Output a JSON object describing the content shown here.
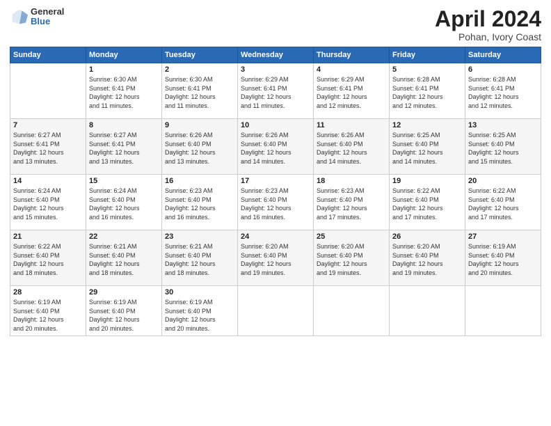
{
  "header": {
    "logo_general": "General",
    "logo_blue": "Blue",
    "title": "April 2024",
    "location": "Pohan, Ivory Coast"
  },
  "days_of_week": [
    "Sunday",
    "Monday",
    "Tuesday",
    "Wednesday",
    "Thursday",
    "Friday",
    "Saturday"
  ],
  "weeks": [
    [
      {
        "day": "",
        "info": ""
      },
      {
        "day": "1",
        "info": "Sunrise: 6:30 AM\nSunset: 6:41 PM\nDaylight: 12 hours\nand 11 minutes."
      },
      {
        "day": "2",
        "info": "Sunrise: 6:30 AM\nSunset: 6:41 PM\nDaylight: 12 hours\nand 11 minutes."
      },
      {
        "day": "3",
        "info": "Sunrise: 6:29 AM\nSunset: 6:41 PM\nDaylight: 12 hours\nand 11 minutes."
      },
      {
        "day": "4",
        "info": "Sunrise: 6:29 AM\nSunset: 6:41 PM\nDaylight: 12 hours\nand 12 minutes."
      },
      {
        "day": "5",
        "info": "Sunrise: 6:28 AM\nSunset: 6:41 PM\nDaylight: 12 hours\nand 12 minutes."
      },
      {
        "day": "6",
        "info": "Sunrise: 6:28 AM\nSunset: 6:41 PM\nDaylight: 12 hours\nand 12 minutes."
      }
    ],
    [
      {
        "day": "7",
        "info": "Sunrise: 6:27 AM\nSunset: 6:41 PM\nDaylight: 12 hours\nand 13 minutes."
      },
      {
        "day": "8",
        "info": "Sunrise: 6:27 AM\nSunset: 6:41 PM\nDaylight: 12 hours\nand 13 minutes."
      },
      {
        "day": "9",
        "info": "Sunrise: 6:26 AM\nSunset: 6:40 PM\nDaylight: 12 hours\nand 13 minutes."
      },
      {
        "day": "10",
        "info": "Sunrise: 6:26 AM\nSunset: 6:40 PM\nDaylight: 12 hours\nand 14 minutes."
      },
      {
        "day": "11",
        "info": "Sunrise: 6:26 AM\nSunset: 6:40 PM\nDaylight: 12 hours\nand 14 minutes."
      },
      {
        "day": "12",
        "info": "Sunrise: 6:25 AM\nSunset: 6:40 PM\nDaylight: 12 hours\nand 14 minutes."
      },
      {
        "day": "13",
        "info": "Sunrise: 6:25 AM\nSunset: 6:40 PM\nDaylight: 12 hours\nand 15 minutes."
      }
    ],
    [
      {
        "day": "14",
        "info": "Sunrise: 6:24 AM\nSunset: 6:40 PM\nDaylight: 12 hours\nand 15 minutes."
      },
      {
        "day": "15",
        "info": "Sunrise: 6:24 AM\nSunset: 6:40 PM\nDaylight: 12 hours\nand 16 minutes."
      },
      {
        "day": "16",
        "info": "Sunrise: 6:23 AM\nSunset: 6:40 PM\nDaylight: 12 hours\nand 16 minutes."
      },
      {
        "day": "17",
        "info": "Sunrise: 6:23 AM\nSunset: 6:40 PM\nDaylight: 12 hours\nand 16 minutes."
      },
      {
        "day": "18",
        "info": "Sunrise: 6:23 AM\nSunset: 6:40 PM\nDaylight: 12 hours\nand 17 minutes."
      },
      {
        "day": "19",
        "info": "Sunrise: 6:22 AM\nSunset: 6:40 PM\nDaylight: 12 hours\nand 17 minutes."
      },
      {
        "day": "20",
        "info": "Sunrise: 6:22 AM\nSunset: 6:40 PM\nDaylight: 12 hours\nand 17 minutes."
      }
    ],
    [
      {
        "day": "21",
        "info": "Sunrise: 6:22 AM\nSunset: 6:40 PM\nDaylight: 12 hours\nand 18 minutes."
      },
      {
        "day": "22",
        "info": "Sunrise: 6:21 AM\nSunset: 6:40 PM\nDaylight: 12 hours\nand 18 minutes."
      },
      {
        "day": "23",
        "info": "Sunrise: 6:21 AM\nSunset: 6:40 PM\nDaylight: 12 hours\nand 18 minutes."
      },
      {
        "day": "24",
        "info": "Sunrise: 6:20 AM\nSunset: 6:40 PM\nDaylight: 12 hours\nand 19 minutes."
      },
      {
        "day": "25",
        "info": "Sunrise: 6:20 AM\nSunset: 6:40 PM\nDaylight: 12 hours\nand 19 minutes."
      },
      {
        "day": "26",
        "info": "Sunrise: 6:20 AM\nSunset: 6:40 PM\nDaylight: 12 hours\nand 19 minutes."
      },
      {
        "day": "27",
        "info": "Sunrise: 6:19 AM\nSunset: 6:40 PM\nDaylight: 12 hours\nand 20 minutes."
      }
    ],
    [
      {
        "day": "28",
        "info": "Sunrise: 6:19 AM\nSunset: 6:40 PM\nDaylight: 12 hours\nand 20 minutes."
      },
      {
        "day": "29",
        "info": "Sunrise: 6:19 AM\nSunset: 6:40 PM\nDaylight: 12 hours\nand 20 minutes."
      },
      {
        "day": "30",
        "info": "Sunrise: 6:19 AM\nSunset: 6:40 PM\nDaylight: 12 hours\nand 20 minutes."
      },
      {
        "day": "",
        "info": ""
      },
      {
        "day": "",
        "info": ""
      },
      {
        "day": "",
        "info": ""
      },
      {
        "day": "",
        "info": ""
      }
    ]
  ]
}
